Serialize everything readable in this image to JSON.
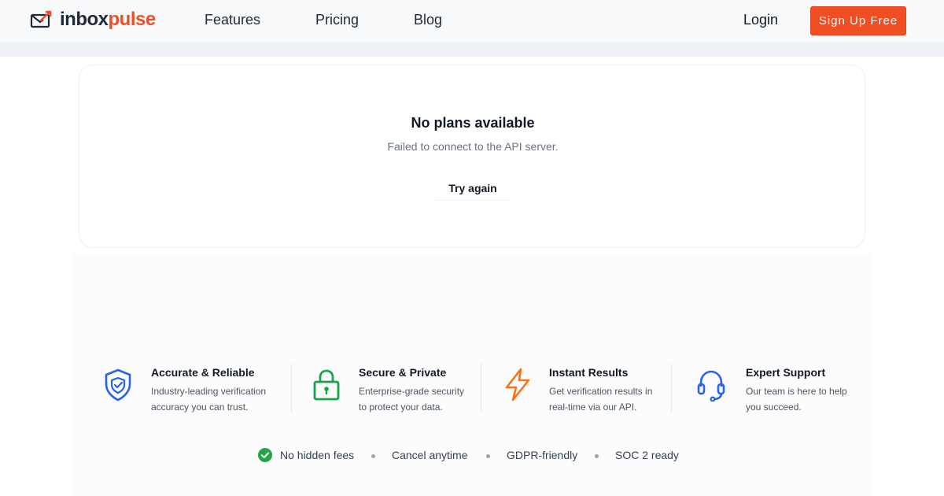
{
  "brand": {
    "name_dark": "inbox",
    "name_accent": "pulse",
    "accent_color": "#f04e23"
  },
  "nav": {
    "items": [
      "Features",
      "Pricing",
      "Blog"
    ],
    "login": "Login",
    "signup": "Sign Up Free"
  },
  "card": {
    "title": "No plans available",
    "message": "Failed to connect to the API server.",
    "retry": "Try again"
  },
  "features": [
    {
      "icon": "shield-icon",
      "title": "Accurate & Reliable",
      "line1": "Industry-leading verification",
      "line2": "accuracy you can trust.",
      "color": "#2563eb"
    },
    {
      "icon": "lock-icon",
      "title": "Secure & Private",
      "line1": "Enterprise-grade security",
      "line2": "to protect your data.",
      "color": "#16a34a"
    },
    {
      "icon": "lightning-icon",
      "title": "Instant Results",
      "line1": "Get verification results in",
      "line2": "real-time via our API.",
      "color": "#f97316"
    },
    {
      "icon": "headset-icon",
      "title": "Expert Support",
      "line1": "Our team is here to help",
      "line2": "you succeed.",
      "color": "#2563eb"
    }
  ],
  "perks": [
    "No hidden fees",
    "Cancel anytime",
    "GDPR-friendly",
    "SOC 2 ready"
  ]
}
